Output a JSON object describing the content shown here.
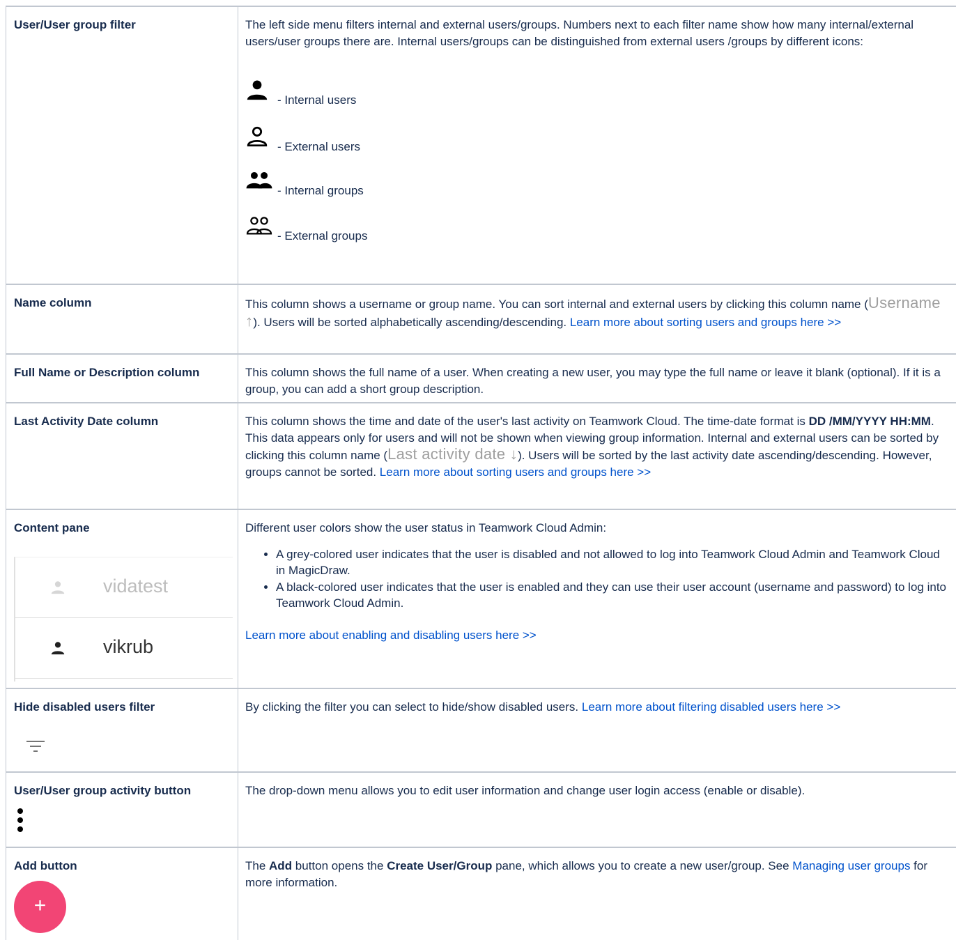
{
  "rows": {
    "filter": {
      "header": "User/User group filter",
      "text": "The left side menu filters internal and external users/groups. Numbers next to each filter name show how many internal/external users/user groups there are. Internal users/groups can be distinguished from external users /groups by different icons:",
      "legend": [
        {
          "icon": "internal-user-icon",
          "label": "- Internal users"
        },
        {
          "icon": "external-user-icon",
          "label": "- External users"
        },
        {
          "icon": "internal-group-icon",
          "label": "- Internal groups"
        },
        {
          "icon": "external-group-icon",
          "label": "- External groups"
        }
      ]
    },
    "name_col": {
      "header": "Name column",
      "text_a": "This column shows a username or group name. You can sort internal and external users by clicking this column name (",
      "inline_label": "Username",
      "text_b": "). Users will be sorted alphabetically ascending/descending. ",
      "link": "Learn more about sorting users and groups here >>"
    },
    "fullname_col": {
      "header": "Full Name or Description column",
      "text": "This column shows the full name of a user. When creating a new user, you may type the full name or leave it blank (optional). If it is a group, you can add a short group description."
    },
    "last_activity": {
      "header": "Last Activity Date column",
      "text_a": "This column shows the time and date of the user's last activity on Teamwork Cloud. The time-date format is ",
      "bold_format": "DD /MM/YYYY HH:MM",
      "text_b": ". This data appears only for users and will not be shown when viewing group information. Internal and external users can be sorted by clicking this column name (",
      "inline_label": "Last activity date",
      "text_c": "). Users will be sorted by the last activity date ascending/descending. However, groups cannot be sorted. ",
      "link": "Learn more about sorting users and groups here >>"
    },
    "content_pane": {
      "header": "Content pane",
      "intro": "Different user colors show the user status in Teamwork Cloud Admin:",
      "bullets": [
        "A grey-colored user indicates that the user is disabled and not allowed to log into Teamwork Cloud Admin and Teamwork Cloud in MagicDraw.",
        "A black-colored user indicates that the user is enabled and they can use their user account (username and password) to log into Teamwork Cloud Admin."
      ],
      "link": "Learn more about enabling and disabling users here >>",
      "preview_users": [
        {
          "name": "vidatest",
          "status": "disabled",
          "color": "#bdbdbd"
        },
        {
          "name": "vikrub",
          "status": "enabled",
          "color": "#212121"
        }
      ]
    },
    "hide_disabled": {
      "header": "Hide disabled users filter",
      "text": "By clicking the filter you can select to hide/show disabled users. ",
      "link": "Learn more about filtering disabled users here >>"
    },
    "activity_button": {
      "header": "User/User group activity button",
      "text": "The drop-down menu allows you to edit user information and change user login access (enable or disable)."
    },
    "add_button": {
      "header": "Add button",
      "text_a": "The ",
      "bold_add": "Add",
      "text_b": " button opens the ",
      "bold_pane": "Create User/Group",
      "text_c": " pane, which allows you to create a new user/group. See ",
      "link": "Managing user groups",
      "text_d": " for more information.",
      "fab_symbol": "+",
      "fab_color": "#f24575"
    }
  },
  "colors": {
    "link": "#0052cc",
    "border": "#c1c7d0",
    "text": "#172b4d"
  }
}
